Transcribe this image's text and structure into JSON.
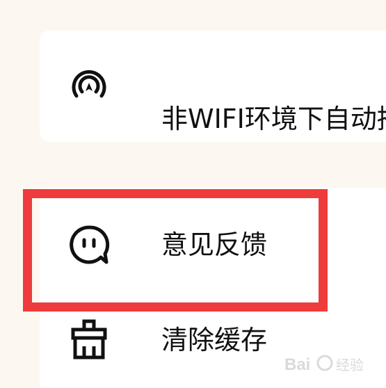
{
  "settings": {
    "items": [
      {
        "id": "autoplay",
        "label": "非WIFI环境下自动播",
        "icon": "wireless-play-icon"
      },
      {
        "id": "feedback",
        "label": "意见反馈",
        "icon": "chat-bubble-icon"
      },
      {
        "id": "clear_cache",
        "label": "清除缓存",
        "icon": "broom-icon"
      }
    ]
  },
  "annotation": {
    "highlight_color": "#ee3b3b"
  },
  "watermark": {
    "text": "Bai 经验"
  }
}
